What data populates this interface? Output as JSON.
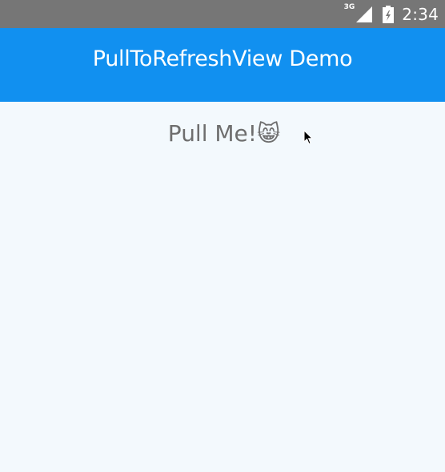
{
  "status_bar": {
    "network_type": "3G",
    "signal_icon": "signal-icon",
    "battery_icon": "battery-icon",
    "time": "2:34"
  },
  "app_bar": {
    "title": "PullToRefreshView Demo",
    "color": "#1190f0"
  },
  "content": {
    "pull_label": "Pull Me!😸",
    "background": "#f3f9fd"
  },
  "cursor_icon": "mouse-pointer-icon"
}
